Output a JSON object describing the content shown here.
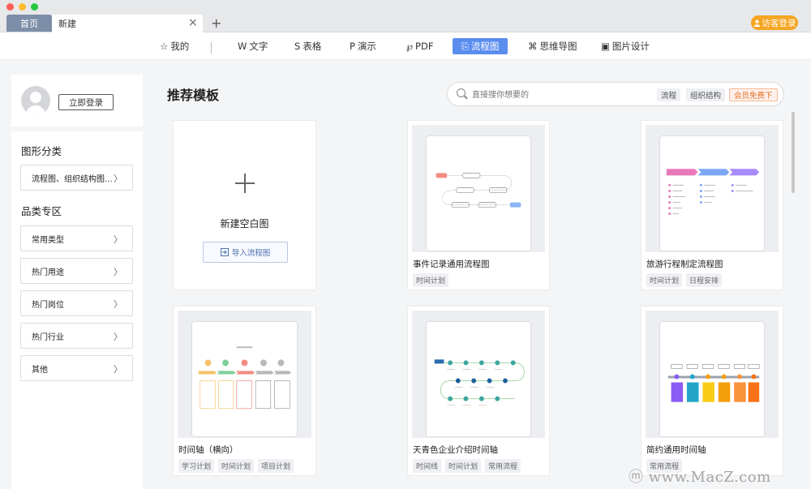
{
  "tabs": {
    "home": "首页",
    "active": "新建",
    "close": "×",
    "add": "+"
  },
  "guest_login": "访客登录",
  "nav": [
    {
      "label": "我的",
      "icon": "☆"
    },
    {
      "label": "文字",
      "icon": "W"
    },
    {
      "label": "表格",
      "icon": "S"
    },
    {
      "label": "演示",
      "icon": "P"
    },
    {
      "label": "PDF",
      "icon": "℘"
    },
    {
      "label": "流程图",
      "icon": "⎘"
    },
    {
      "label": "思维导图",
      "icon": "⌘"
    },
    {
      "label": "图片设计",
      "icon": "▣"
    }
  ],
  "sidebar": {
    "login": "立即登录",
    "section1_title": "图形分类",
    "section1_item": "流程图、组织结构图...",
    "section2_title": "品类专区",
    "items": [
      "常用类型",
      "热门用途",
      "热门岗位",
      "热门行业",
      "其他"
    ]
  },
  "main": {
    "title": "推荐模板",
    "search": {
      "placeholder": "直接搜你想要的",
      "tags": [
        "流程",
        "组织结构",
        "会员免费下"
      ]
    },
    "new_blank": "新建空白图",
    "import": "导入流程图"
  },
  "cards": [
    {
      "title": "事件记录通用流程图",
      "tags": [
        "时间计划"
      ]
    },
    {
      "title": "旅游行程制定流程图",
      "tags": [
        "时间计划",
        "日程安排"
      ]
    },
    {
      "title": "时间轴（横向）",
      "tags": [
        "学习计划",
        "时间计划",
        "项目计划"
      ]
    },
    {
      "title": "天青色企业介绍时间轴",
      "tags": [
        "时间线",
        "时间计划",
        "常用流程"
      ]
    },
    {
      "title": "简约通用时间轴",
      "tags": [
        "常用流程"
      ]
    }
  ],
  "watermark": "ⓜ www.MacZ.com",
  "colors": {
    "accent": "#5b8def",
    "guest": "#f5a623",
    "vip": "#e2702a"
  }
}
